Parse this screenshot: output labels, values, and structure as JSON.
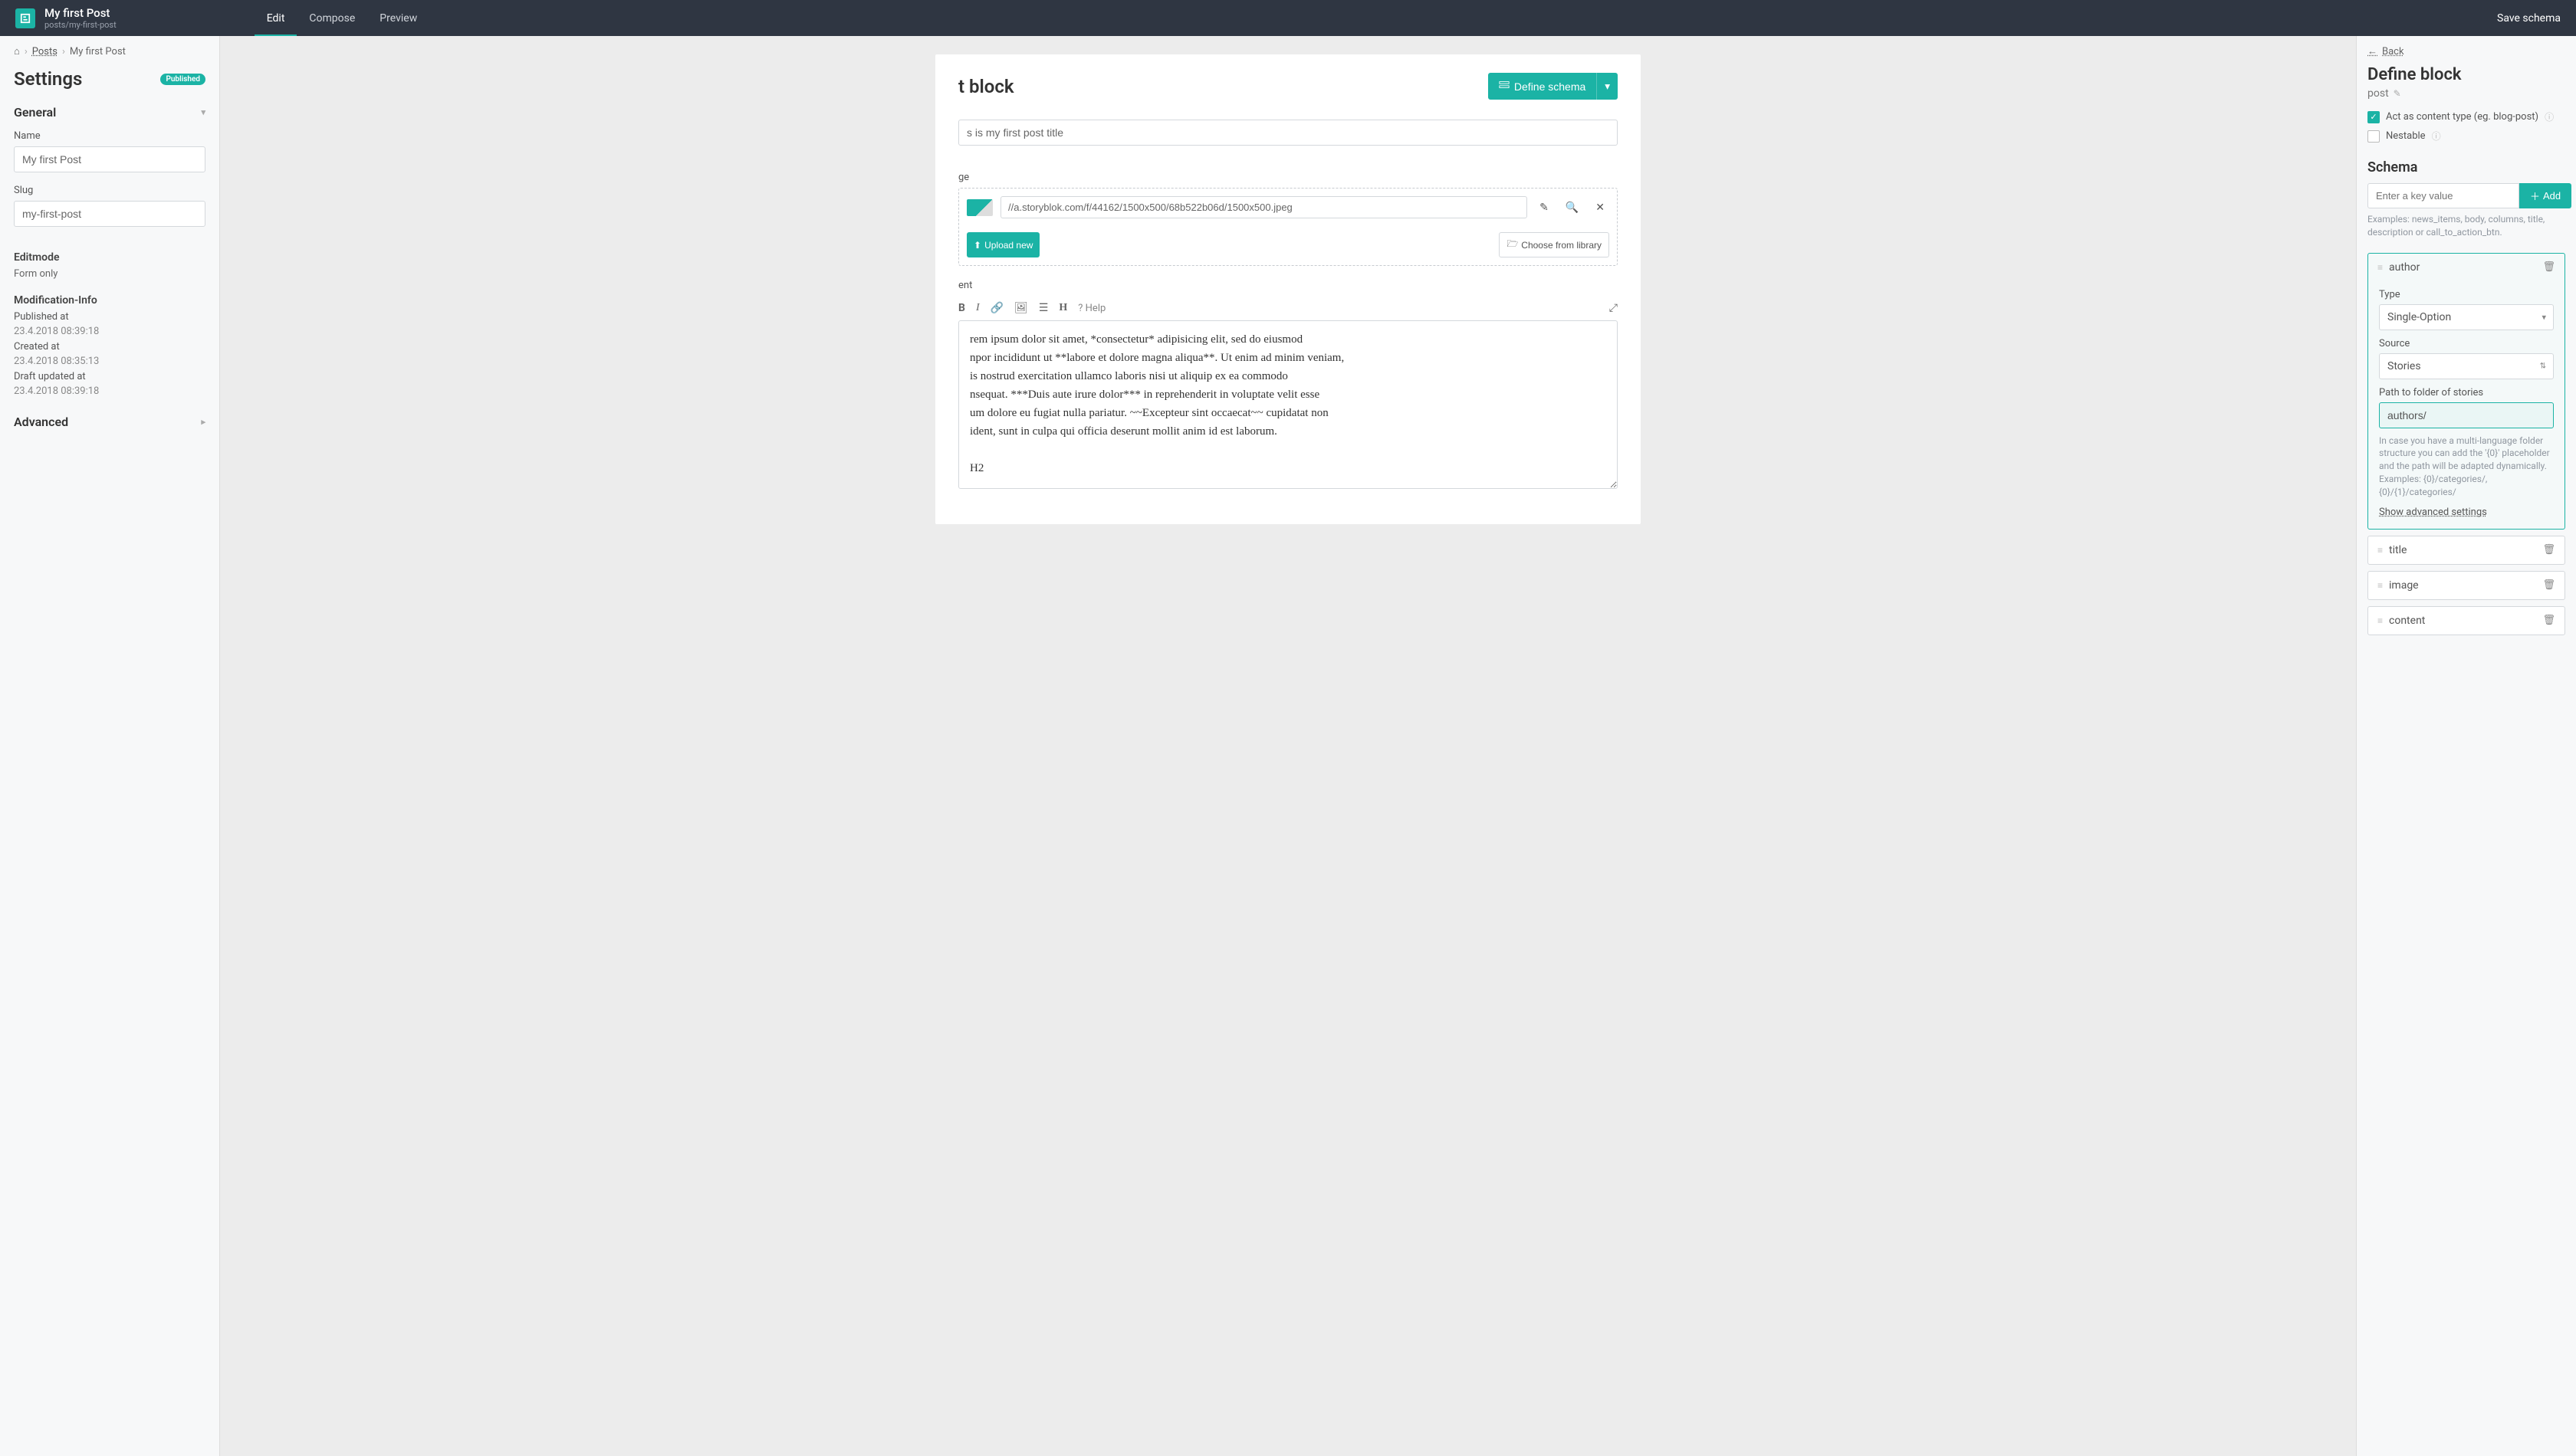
{
  "topbar": {
    "title": "My first Post",
    "subtitle": "posts/my-first-post",
    "tabs": {
      "edit": "Edit",
      "compose": "Compose",
      "preview": "Preview"
    },
    "save": "Save schema"
  },
  "left": {
    "breadcrumb": {
      "home": "⌂",
      "posts": "Posts",
      "current": "My first Post"
    },
    "settings": "Settings",
    "published_badge": "Published",
    "general": "General",
    "name_label": "Name",
    "name_value": "My first Post",
    "slug_label": "Slug",
    "slug_value": "my-first-post",
    "editmode_label": "Editmode",
    "editmode_value": "Form only",
    "modinfo": "Modification-Info",
    "pub_at": "Published at",
    "pub_at_v": "23.4.2018 08:39:18",
    "created_at": "Created at",
    "created_at_v": "23.4.2018 08:35:13",
    "draft_at": "Draft updated at",
    "draft_at_v": "23.4.2018 08:39:18",
    "advanced": "Advanced"
  },
  "center": {
    "block_title": "t block",
    "define_schema": "Define schema",
    "title_value": "s is my first post title",
    "image_label": "ge",
    "image_url": "//a.storyblok.com/f/44162/1500x500/68b522b06d/1500x500.jpeg",
    "upload": "Upload new",
    "library": "Choose from library",
    "content_label": "ent",
    "help": "Help",
    "content_body": "rem ipsum dolor sit amet, *consectetur* adipisicing elit, sed do eiusmod\nnpor incididunt ut **labore et dolore magna aliqua**. Ut enim ad minim veniam,\nis nostrud exercitation ullamco laboris nisi ut aliquip ex ea commodo\nnsequat. ***Duis aute irure dolor*** in reprehenderit in voluptate velit esse\num dolore eu fugiat nulla pariatur. ~~Excepteur sint occaecat~~ cupidatat non\nident, sunt in culpa qui officia deserunt mollit anim id est laborum.\n\nH2"
  },
  "right": {
    "back": "Back",
    "define_block": "Define block",
    "block_name": "post",
    "act_as": "Act as content type (eg. blog-post)",
    "nestable": "Nestable",
    "schema": "Schema",
    "key_placeholder": "Enter a key value",
    "add": "Add",
    "examples": "Examples: news_items, body, columns, title, description or call_to_action_btn.",
    "fields": {
      "author": "author",
      "title": "title",
      "image": "image",
      "content": "content"
    },
    "author_panel": {
      "type_label": "Type",
      "type_value": "Single-Option",
      "source_label": "Source",
      "source_value": "Stories",
      "path_label": "Path to folder of stories",
      "path_value": "authors/",
      "path_hint": "In case you have a multi-language folder structure you can add the '{0}' placeholder and the path will be adapted dynamically. Examples: {0}/categories/, {0}/{1}/categories/",
      "adv": "Show advanced settings"
    }
  }
}
